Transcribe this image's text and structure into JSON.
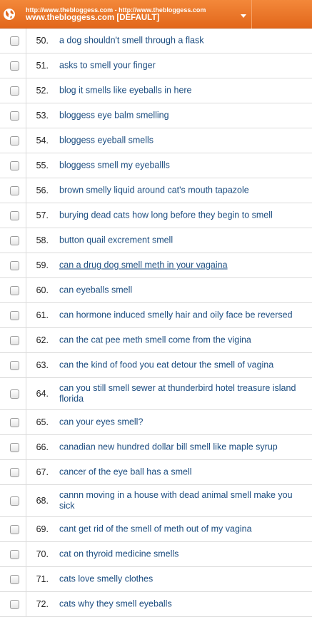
{
  "header": {
    "url_line": "http://www.thebloggess.com - http://www.thebloggess.com",
    "site_line": "www.thebloggess.com [DEFAULT]"
  },
  "rows": [
    {
      "num": "50.",
      "text": "a dog shouldn't smell through a flask"
    },
    {
      "num": "51.",
      "text": "asks to smell your finger"
    },
    {
      "num": "52.",
      "text": "blog it smells like eyeballs in here"
    },
    {
      "num": "53.",
      "text": "bloggess eye balm smelling"
    },
    {
      "num": "54.",
      "text": "bloggess eyeball smells"
    },
    {
      "num": "55.",
      "text": "bloggess smell my eyeballls"
    },
    {
      "num": "56.",
      "text": "brown smelly liquid around cat's mouth tapazole"
    },
    {
      "num": "57.",
      "text": "burying dead cats how long before they begin to smell"
    },
    {
      "num": "58.",
      "text": "button quail excrement smell"
    },
    {
      "num": "59.",
      "text": "can a drug dog smell meth in your vagaina"
    },
    {
      "num": "60.",
      "text": "can eyeballs smell"
    },
    {
      "num": "61.",
      "text": "can hormone induced smelly hair and oily face be reversed"
    },
    {
      "num": "62.",
      "text": "can the cat pee meth smell come from the vigina"
    },
    {
      "num": "63.",
      "text": "can the kind of food you eat detour the smell of vagina"
    },
    {
      "num": "64.",
      "text": "can you still smell sewer at thunderbird hotel treasure island florida"
    },
    {
      "num": "65.",
      "text": "can your eyes smell?"
    },
    {
      "num": "66.",
      "text": "canadian new hundred dollar bill smell like maple syrup"
    },
    {
      "num": "67.",
      "text": "cancer of the eye ball has a smell"
    },
    {
      "num": "68.",
      "text": "cannn moving in a house with dead animal smell make you sick"
    },
    {
      "num": "69.",
      "text": "cant get rid of the smell of meth out of my vagina"
    },
    {
      "num": "70.",
      "text": "cat on thyroid medicine smells"
    },
    {
      "num": "71.",
      "text": "cats love smelly clothes"
    },
    {
      "num": "72.",
      "text": "cats why they smell eyeballs"
    }
  ]
}
